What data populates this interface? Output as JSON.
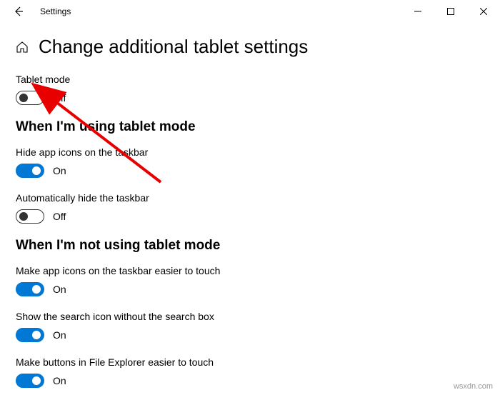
{
  "window": {
    "app_title": "Settings"
  },
  "page": {
    "title": "Change additional tablet settings"
  },
  "tablet_mode": {
    "label": "Tablet mode",
    "state": "Off"
  },
  "sections": {
    "using_tablet": {
      "heading": "When I'm using tablet mode",
      "hide_icons": {
        "label": "Hide app icons on the taskbar",
        "state": "On"
      },
      "auto_hide_taskbar": {
        "label": "Automatically hide the taskbar",
        "state": "Off"
      }
    },
    "not_using_tablet": {
      "heading": "When I'm not using tablet mode",
      "easier_icons": {
        "label": "Make app icons on the taskbar easier to touch",
        "state": "On"
      },
      "search_icon": {
        "label": "Show the search icon without the search box",
        "state": "On"
      },
      "file_explorer": {
        "label": "Make buttons in File Explorer easier to touch",
        "state": "On"
      }
    }
  },
  "watermark": "wsxdn.com"
}
